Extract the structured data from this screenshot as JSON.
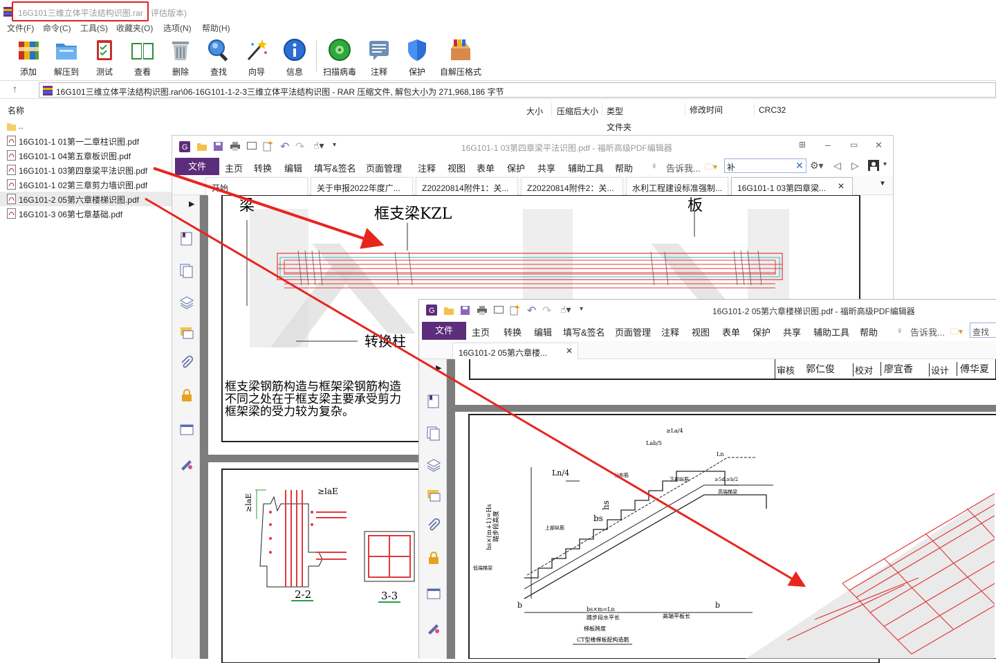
{
  "window": {
    "title": "16G101三维立体平法结构识图.rar",
    "title_suffix": "评估版本)"
  },
  "menu": [
    "文件(F)",
    "命令(C)",
    "工具(S)",
    "收藏夹(O)",
    "选项(N)",
    "帮助(H)"
  ],
  "toolbar": [
    {
      "label": "添加",
      "icon": "books-add-icon"
    },
    {
      "label": "解压到",
      "icon": "folder-extract-icon"
    },
    {
      "label": "测试",
      "icon": "clipboard-check-icon"
    },
    {
      "label": "查看",
      "icon": "open-book-icon"
    },
    {
      "label": "删除",
      "icon": "trash-can-icon"
    },
    {
      "label": "查找",
      "icon": "magnifier-icon"
    },
    {
      "label": "向导",
      "icon": "magic-wand-icon"
    },
    {
      "label": "信息",
      "icon": "info-icon"
    },
    {
      "label": "扫描病毒",
      "icon": "virus-scan-icon"
    },
    {
      "label": "注释",
      "icon": "comment-icon"
    },
    {
      "label": "保护",
      "icon": "shield-icon"
    },
    {
      "label": "自解压格式",
      "icon": "sfx-box-icon"
    }
  ],
  "address": {
    "path": "16G101三维立体平法结构识图.rar\\06-16G101-1-2-3三维立体平法结构识图 - RAR 压缩文件, 解包大小为 271,968,186 字节"
  },
  "columns": {
    "name": "名称",
    "size": "大小",
    "packed": "压缩后大小",
    "type": "类型",
    "modified": "修改时间",
    "crc": "CRC32",
    "folder_type": "文件夹"
  },
  "files": [
    "..",
    "16G101-1 01第一二章柱识图.pdf",
    "16G101-1 04第五章板识图.pdf",
    "16G101-1 03第四章梁平法识图.pdf",
    "16G101-1 02第三章剪力墙识图.pdf",
    "16G101-2 05第六章楼梯识图.pdf",
    "16G101-3 06第七章基础.pdf"
  ],
  "pdf1": {
    "title": "16G101-1 03第四章梁平法识图.pdf - 福昕高级PDF编辑器",
    "file_button": "文件",
    "ribbon": [
      "主页",
      "转换",
      "编辑",
      "填写&签名",
      "页面管理",
      "注释",
      "视图",
      "表单",
      "保护",
      "共享",
      "辅助工具",
      "帮助"
    ],
    "tell_me": "告诉我...",
    "search_value": "补",
    "tabs": [
      "开始",
      "关于申报2022年度广...",
      "Z20220814附件1：关...",
      "Z20220814附件2：关...",
      "水利工程建设标准强制...",
      "16G101-1 03第四章梁..."
    ],
    "drawing": {
      "label_liang": "梁",
      "label_kzl": "框支梁KZL",
      "label_ban": "板",
      "label_zhuanhuanzhu": "转换柱",
      "desc_line1": "框支梁钢筋构造与框架梁钢筋构造",
      "desc_line2": "不同之处在于框支梁主要承受剪力",
      "desc_line3": "框架梁的受力较为复杂。",
      "dim_lae": "≥laE",
      "dim_lae_vert": "≥laE",
      "section_22": "2-2",
      "section_33": "3-3"
    }
  },
  "pdf2": {
    "title": "16G101-2 05第六章楼梯识图.pdf - 福昕高级PDF编辑器",
    "file_button": "文件",
    "ribbon": [
      "主页",
      "转换",
      "编辑",
      "填写&签名",
      "页面管理",
      "注释",
      "视图",
      "表单",
      "保护",
      "共享",
      "辅助工具",
      "帮助"
    ],
    "tell_me": "告诉我...",
    "search_placeholder": "查找",
    "tabs": [
      "16G101-2 05第六章楼..."
    ],
    "titleblock": [
      "审核",
      "郭仁俊",
      "校对",
      "廖宜香",
      "设计",
      "傅华夏"
    ],
    "drawing": {
      "ln4": "Ln/4",
      "ln4b": "≥La/4",
      "lab": "Lab/5",
      "hs": "hs×(m+1)=Hs",
      "hs2": "踏步段高度",
      "bs": "bs",
      "hs3": "hs",
      "b1": "b",
      "b2": "b",
      "bsm": "bs×m=Ln",
      "step_len": "踏步段水平长",
      "high_len": "高端平板长",
      "span": "梯板跨度",
      "caption": "CT型楼梯板配构造筋",
      "low_beam": "低端梯梁",
      "high_beam": "高端梯梁",
      "ln": "Ln",
      "top_bar": "上部纵筋",
      "low_bar": "下部纵筋",
      "dist": "分布筋",
      "d5": "≥5d,≥b/2"
    }
  },
  "colors": {
    "winrar_title_box": "#e0201b",
    "annotation_arrow": "#e8251d",
    "foxit_purple": "#5c2d7a",
    "rebar_red": "#e0393c"
  }
}
